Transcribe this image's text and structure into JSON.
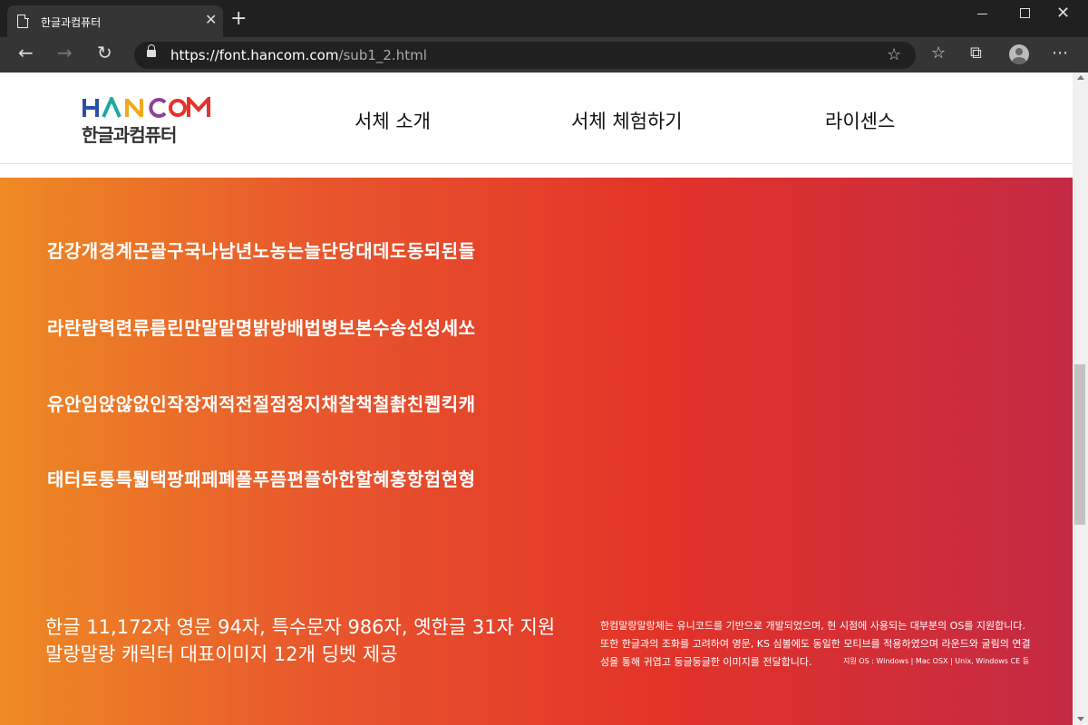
{
  "browser": {
    "tab_title": "한글과컴퓨터",
    "tab_close": "✕",
    "new_tab": "+",
    "url_host": "https://font.hancom.com",
    "url_path": "/sub1_2.html",
    "back_glyph": "←",
    "forward_glyph": "→",
    "refresh_glyph": "↻",
    "favorites_glyph": "☆",
    "collections_glyph": "⧉",
    "more_glyph": "⋯",
    "close_glyph": "✕"
  },
  "header": {
    "logo_text": "한글과컴퓨터",
    "menu": [
      "서체 소개",
      "서체 체험하기",
      "라이센스"
    ]
  },
  "hero": {
    "glyph_lines": [
      "감강개경계곤골구국나남년노농는늘단당대데도동되된들",
      "라란람력련류름린만말맡명밝방배법병보본수송선성세쏘",
      "유안임앉않없인작장재적전절점정지채찰책철촭친퀩킥캐",
      "태터토통특퉯택팡패페폐폴푸픔편플하한할혜홍항험현형"
    ],
    "feature_lines": [
      "한글 11,172자 영문 94자, 특수문자 986자, 옛한글 31자 지원",
      "말랑말랑 캐릭터 대표이미지 12개 딩벳 제공"
    ],
    "description_lines": [
      "한컴말랑말랑체는 유니코드를 기반으로 개발되었으며, 현 시점에 사용되는 대부분의 OS를 지원합니다.",
      "또한 한글과의 조화를 고려하여 영문, KS 심볼에도 동일한 모티브를 적용하였으며 라운드와 굴림의 연결",
      "성을 통해 귀엽고 둥글둥글한 이미지를 전달합니다."
    ],
    "support_text": "지원 OS : Windows | Mac OSX | Unix, Windows CE 등"
  }
}
